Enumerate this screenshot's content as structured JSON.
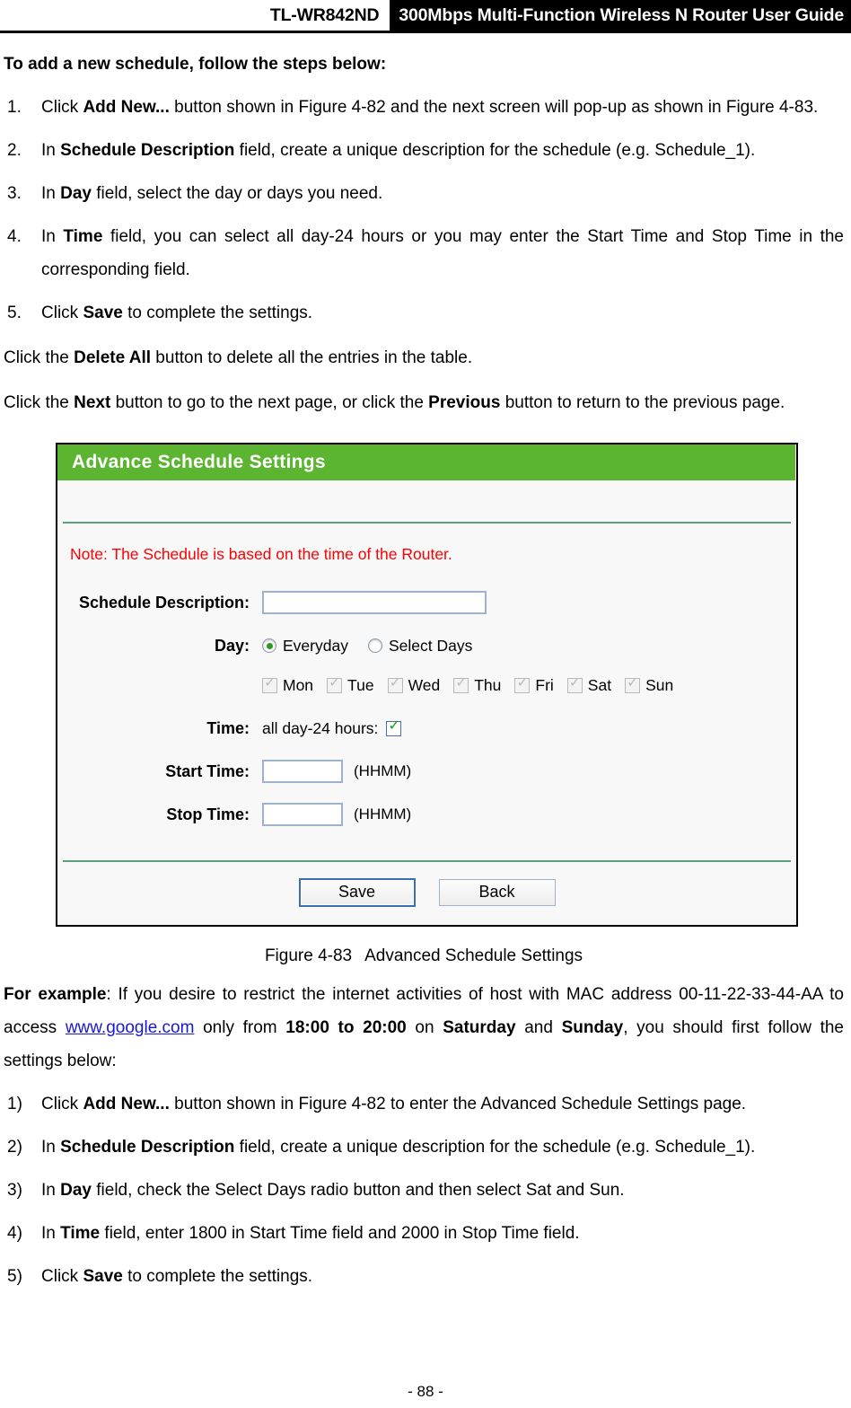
{
  "header": {
    "model": "TL-WR842ND",
    "title": "300Mbps Multi-Function Wireless N Router User Guide"
  },
  "lead": "To add a new schedule, follow the steps below:",
  "steps_numeric": [
    {
      "marker": "1.",
      "parts": [
        {
          "t": "Click ",
          "b": false
        },
        {
          "t": "Add New...",
          "b": true
        },
        {
          "t": " button shown in Figure 4-82 and the next screen will pop-up as shown in Figure 4-83.",
          "b": false
        }
      ]
    },
    {
      "marker": "2.",
      "parts": [
        {
          "t": "In ",
          "b": false
        },
        {
          "t": "Schedule Description",
          "b": true
        },
        {
          "t": " field, create a unique description for the schedule (e.g. Schedule_1).",
          "b": false
        }
      ]
    },
    {
      "marker": "3.",
      "parts": [
        {
          "t": "In ",
          "b": false
        },
        {
          "t": "Day",
          "b": true
        },
        {
          "t": " field, select the day or days you need.",
          "b": false
        }
      ]
    },
    {
      "marker": "4.",
      "parts": [
        {
          "t": "In ",
          "b": false
        },
        {
          "t": "Time",
          "b": true
        },
        {
          "t": " field, you can select all day-24 hours or you may enter the Start Time and Stop Time in the corresponding field.",
          "b": false
        }
      ]
    },
    {
      "marker": "5.",
      "parts": [
        {
          "t": "Click ",
          "b": false
        },
        {
          "t": "Save",
          "b": true
        },
        {
          "t": " to complete the settings.",
          "b": false
        }
      ]
    }
  ],
  "paragraphs_after_steps": [
    {
      "parts": [
        {
          "t": "Click the ",
          "b": false
        },
        {
          "t": "Delete All",
          "b": true
        },
        {
          "t": " button to delete all the entries in the table.",
          "b": false
        }
      ]
    },
    {
      "parts": [
        {
          "t": "Click the ",
          "b": false
        },
        {
          "t": "Next",
          "b": true
        },
        {
          "t": " button to go to the next page, or click the ",
          "b": false
        },
        {
          "t": "Previous",
          "b": true
        },
        {
          "t": " button to return to the previous page.",
          "b": false
        }
      ]
    }
  ],
  "router_ui": {
    "title": "Advance Schedule Settings",
    "note": "Note: The Schedule is based on the time of the Router.",
    "labels": {
      "schedule_description": "Schedule Description:",
      "day": "Day:",
      "time": "Time:",
      "start_time": "Start Time:",
      "stop_time": "Stop Time:"
    },
    "schedule_description_value": "",
    "day_radios": [
      {
        "label": "Everyday",
        "selected": true
      },
      {
        "label": "Select Days",
        "selected": false
      }
    ],
    "days": [
      {
        "label": "Mon",
        "checked": true,
        "enabled": false
      },
      {
        "label": "Tue",
        "checked": true,
        "enabled": false
      },
      {
        "label": "Wed",
        "checked": true,
        "enabled": false
      },
      {
        "label": "Thu",
        "checked": true,
        "enabled": false
      },
      {
        "label": "Fri",
        "checked": true,
        "enabled": false
      },
      {
        "label": "Sat",
        "checked": true,
        "enabled": false
      },
      {
        "label": "Sun",
        "checked": true,
        "enabled": false
      }
    ],
    "all_day_label": "all day-24 hours:",
    "all_day_checked": true,
    "start_time_value": "",
    "stop_time_value": "",
    "time_format_hint": "(HHMM)",
    "buttons": [
      {
        "label": "Save",
        "focused": true
      },
      {
        "label": "Back",
        "focused": false
      }
    ],
    "colors": {
      "title_bar": "#5cb531",
      "note_text": "#ff0000",
      "divider": "#5f9e7c",
      "input_border": "#9db3cd",
      "check_green": "#18a018",
      "panel_bg": "#f8f8f8"
    }
  },
  "figure_caption": {
    "number": "Figure 4-83",
    "title": "Advanced Schedule Settings"
  },
  "example_paragraph": {
    "parts": [
      {
        "t": "For example",
        "b": true
      },
      {
        "t": ": If you desire to restrict the internet activities of host with MAC address 00-11-22-33-44-AA to access ",
        "b": false
      },
      {
        "t": "www.google.com",
        "b": false,
        "link": true
      },
      {
        "t": " only from ",
        "b": false
      },
      {
        "t": "18:00 to 20:00",
        "b": true
      },
      {
        "t": " on ",
        "b": false
      },
      {
        "t": "Saturday",
        "b": true
      },
      {
        "t": " and ",
        "b": false
      },
      {
        "t": "Sunday",
        "b": true
      },
      {
        "t": ", you should first follow the settings below:",
        "b": false
      }
    ]
  },
  "steps_paren": [
    {
      "marker": "1)",
      "parts": [
        {
          "t": "Click ",
          "b": false
        },
        {
          "t": "Add New...",
          "b": true
        },
        {
          "t": " button shown in Figure 4-82 to enter the Advanced Schedule Settings page.",
          "b": false
        }
      ]
    },
    {
      "marker": "2)",
      "parts": [
        {
          "t": "In ",
          "b": false
        },
        {
          "t": "Schedule Description",
          "b": true
        },
        {
          "t": " field, create a unique description for the schedule (e.g. Schedule_1).",
          "b": false
        }
      ]
    },
    {
      "marker": "3)",
      "parts": [
        {
          "t": "In ",
          "b": false
        },
        {
          "t": "Day",
          "b": true
        },
        {
          "t": " field, check the Select Days radio button and then select Sat and Sun.",
          "b": false
        }
      ]
    },
    {
      "marker": "4)",
      "parts": [
        {
          "t": "In ",
          "b": false
        },
        {
          "t": "Time",
          "b": true
        },
        {
          "t": " field, enter 1800 in Start Time field and 2000 in Stop Time field.",
          "b": false
        }
      ]
    },
    {
      "marker": "5)",
      "parts": [
        {
          "t": "Click ",
          "b": false
        },
        {
          "t": "Save",
          "b": true
        },
        {
          "t": " to complete the settings.",
          "b": false
        }
      ]
    }
  ],
  "footer": "- 88 -"
}
